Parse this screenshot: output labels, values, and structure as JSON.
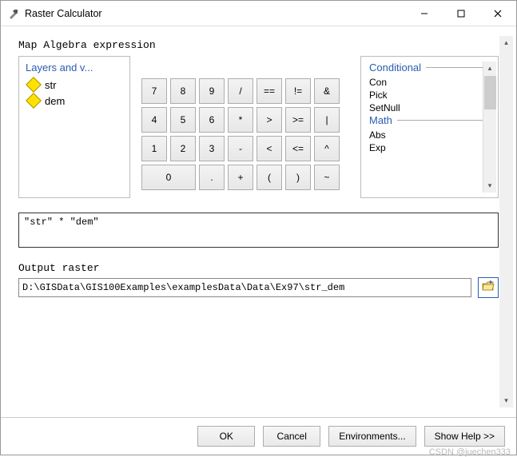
{
  "window": {
    "title": "Raster Calculator"
  },
  "section": {
    "expression_label": "Map Algebra expression",
    "output_label": "Output raster"
  },
  "layers": {
    "header": "Layers and v...",
    "items": [
      {
        "icon": "raster-diamond",
        "label": "str"
      },
      {
        "icon": "raster-diamond",
        "label": "dem"
      }
    ]
  },
  "keypad": {
    "rows": [
      [
        "7",
        "8",
        "9",
        "/",
        "==",
        "!=",
        "&"
      ],
      [
        "4",
        "5",
        "6",
        "*",
        ">",
        ">=",
        "|"
      ],
      [
        "1",
        "2",
        "3",
        "-",
        "<",
        "<=",
        "^"
      ]
    ],
    "lastrow": {
      "zero": "0",
      "rest": [
        ".",
        "+",
        "(",
        ")",
        "~"
      ]
    }
  },
  "tools": {
    "groups": [
      {
        "header": "Conditional",
        "items": [
          "Con",
          "Pick",
          "SetNull"
        ]
      },
      {
        "header": "Math",
        "items": [
          "Abs",
          "Exp"
        ]
      }
    ]
  },
  "expression": {
    "value": "\"str\" * \"dem\""
  },
  "output": {
    "path": "D:\\GISData\\GIS100Examples\\examplesData\\Data\\Ex97\\str_dem"
  },
  "footer": {
    "ok": "OK",
    "cancel": "Cancel",
    "env": "Environments...",
    "help": "Show Help >>"
  },
  "watermark": "CSDN @juechen333"
}
